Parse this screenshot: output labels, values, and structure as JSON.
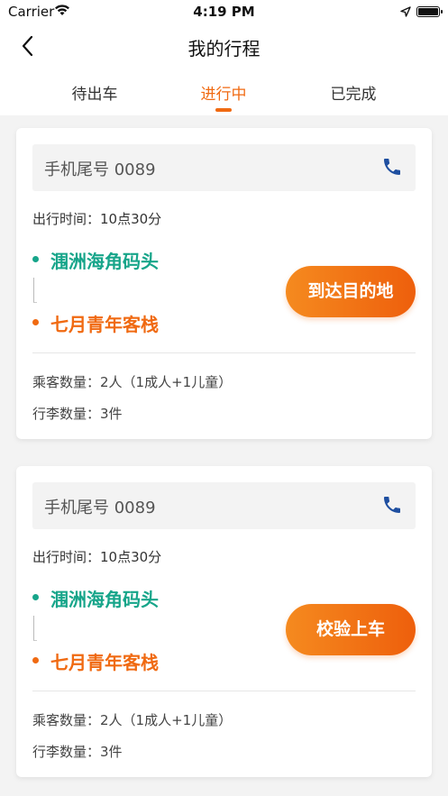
{
  "status_bar": {
    "carrier": "Carrier",
    "time": "4:19 PM"
  },
  "header": {
    "title": "我的行程"
  },
  "tabs": [
    {
      "label": "待出车",
      "active": false
    },
    {
      "label": "进行中",
      "active": true
    },
    {
      "label": "已完成",
      "active": false
    }
  ],
  "colors": {
    "accent": "#f06a12",
    "origin": "#17a58a",
    "destination": "#f06a12"
  },
  "trips": [
    {
      "phone": "手机尾号 0089",
      "depart_time": "出行时间：10点30分",
      "from": "涠洲海角码头",
      "to": "七月青年客栈",
      "action": "到达目的地",
      "passengers": "乘客数量：2人（1成人+1儿童）",
      "luggage": "行李数量：3件"
    },
    {
      "phone": "手机尾号 0089",
      "depart_time": "出行时间：10点30分",
      "from": "涠洲海角码头",
      "to": "七月青年客栈",
      "action": "校验上车",
      "passengers": "乘客数量：2人（1成人+1儿童）",
      "luggage": "行李数量：3件"
    }
  ]
}
